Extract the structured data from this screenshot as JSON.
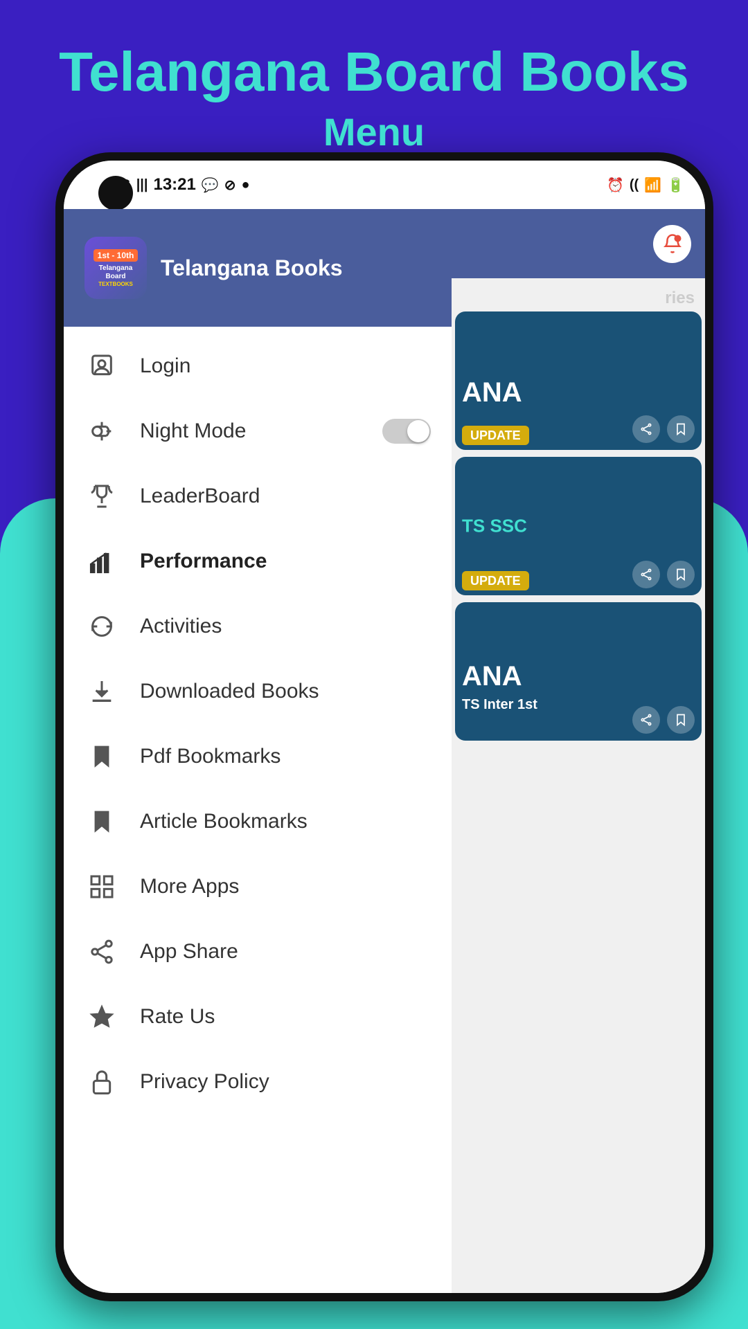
{
  "header": {
    "title": "Telangana Board Books",
    "subtitle": "Menu"
  },
  "phone": {
    "statusBar": {
      "network": "4G",
      "signal": "|||",
      "time": "13:21",
      "icons_left": [
        "whatsapp-icon",
        "vpn-icon",
        "circle-icon"
      ],
      "icons_right": [
        "alarm-icon",
        "nfc-icon",
        "wifi-icon",
        "battery-icon"
      ]
    }
  },
  "drawer": {
    "appName": "Telangana Books",
    "logo": {
      "badge": "1st - 10th",
      "line1": "Telangana",
      "line2": "Board",
      "line3": "TEXTBOOKS"
    },
    "menuItems": [
      {
        "id": "login",
        "label": "Login",
        "icon": "person-icon",
        "active": false
      },
      {
        "id": "night-mode",
        "label": "Night Mode",
        "icon": "night-mode-icon",
        "hasToggle": true,
        "toggleOn": false,
        "active": false
      },
      {
        "id": "leaderboard",
        "label": "LeaderBoard",
        "icon": "trophy-icon",
        "active": false
      },
      {
        "id": "performance",
        "label": "Performance",
        "icon": "chart-icon",
        "active": true,
        "bold": true
      },
      {
        "id": "activities",
        "label": "Activities",
        "icon": "refresh-icon",
        "active": false
      },
      {
        "id": "downloaded-books",
        "label": "Downloaded Books",
        "icon": "download-icon",
        "active": false
      },
      {
        "id": "pdf-bookmarks",
        "label": "Pdf Bookmarks",
        "icon": "bookmark-icon",
        "active": false
      },
      {
        "id": "article-bookmarks",
        "label": "Article Bookmarks",
        "icon": "bookmark2-icon",
        "active": false
      },
      {
        "id": "more-apps",
        "label": "More Apps",
        "icon": "apps-icon",
        "active": false
      },
      {
        "id": "app-share",
        "label": "App Share",
        "icon": "share-icon",
        "active": false
      },
      {
        "id": "rate-us",
        "label": "Rate Us",
        "icon": "star-icon",
        "active": false
      },
      {
        "id": "privacy-policy",
        "label": "Privacy Policy",
        "icon": "lock-icon",
        "active": false
      }
    ]
  },
  "rightPanel": {
    "cards": [
      {
        "text": "ANA",
        "badge": "UPDATE",
        "subtitle": ""
      },
      {
        "text": "TS SSC",
        "badge": "UPDATE",
        "subtitle": ""
      },
      {
        "text": "ANA",
        "badge": "",
        "subtitle": "TS Inter 1st"
      }
    ]
  },
  "colors": {
    "purple": "#3a1fc1",
    "teal": "#40e0d0",
    "drawerHeader": "#4a5d9c",
    "white": "#ffffff",
    "cardBg": "#1a5276",
    "badgeGold": "#d4ac0d",
    "activeText": "#222222"
  }
}
